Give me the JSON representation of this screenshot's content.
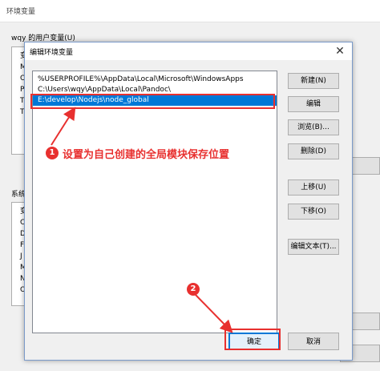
{
  "background_window": {
    "title": "环境变量",
    "user_vars_label": "wqy 的用户变量(U)",
    "user_rows": [
      "变",
      "M",
      "O",
      "P",
      "T",
      "T"
    ],
    "system_vars_label": "系统",
    "system_rows": [
      "变",
      "C",
      "D",
      "F",
      "J",
      "M",
      "N",
      "O"
    ]
  },
  "dialog": {
    "title": "编辑环境变量",
    "close_symbol": "✕",
    "paths": [
      "%USERPROFILE%\\AppData\\Local\\Microsoft\\WindowsApps",
      "C:\\Users\\wqy\\AppData\\Local\\Pandoc\\",
      "E:\\develop\\Nodejs\\node_global"
    ],
    "buttons": {
      "new": "新建(N)",
      "edit": "编辑",
      "browse": "浏览(B)...",
      "delete": "删除(D)",
      "move_up": "上移(U)",
      "move_down": "下移(O)",
      "edit_text": "编辑文本(T)...",
      "ok": "确定",
      "cancel": "取消"
    }
  },
  "annotations": {
    "step1_number": "1",
    "step1_text": "设置为自己创建的全局模块保存位置",
    "step2_number": "2",
    "color": "#e8302f"
  }
}
